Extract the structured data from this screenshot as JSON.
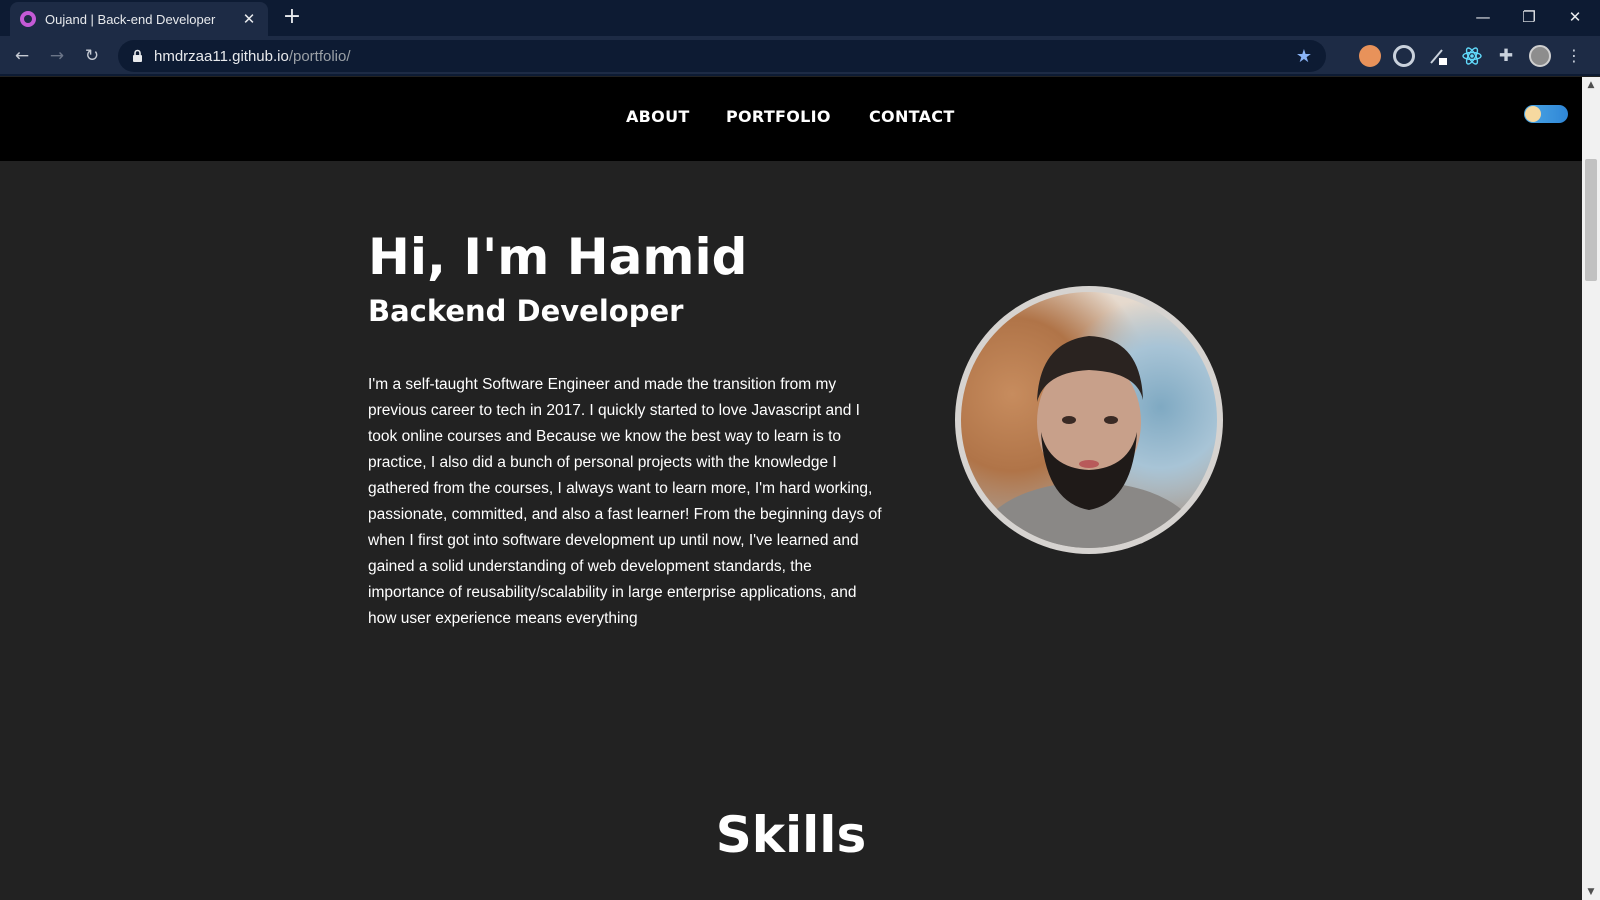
{
  "browser": {
    "tab_title": "Oujand | Back-end Developer",
    "new_tab_label": "+",
    "url_host": "hmdrzaa11.github.io",
    "url_path": "/portfolio/",
    "window_controls": {
      "minimize": "—",
      "restore": "❐",
      "close": "✕"
    },
    "nav": {
      "back": "←",
      "forward": "→",
      "reload": "↻"
    },
    "icons": [
      "lock-icon",
      "star-icon",
      "extension-icons",
      "puzzle-icon",
      "profile-avatar",
      "menu-icon"
    ]
  },
  "header": {
    "nav_links": [
      "ABOUT",
      "PORTFOLIO",
      "CONTACT"
    ]
  },
  "hero": {
    "title": "Hi, I'm Hamid",
    "subtitle": "Backend Developer",
    "bio": "I'm a self-taught Software Engineer and made the transition from my previous career to tech in 2017. I quickly started to love Javascript and I took online courses and Because we know the best way to learn is to practice, I also did a bunch of personal projects with the knowledge I gathered from the courses, I always want to learn more, I'm hard working, passionate, committed, and also a fast learner! From the beginning days of when I first got into software development up until now, I've learned and gained a solid understanding of web development standards, the importance of reusability/scalability in large enterprise applications, and how user experience means everything"
  },
  "skills": {
    "title": "Skills"
  },
  "colors": {
    "page_bg": "#222222",
    "header_bg": "#000000",
    "chrome_bg": "#0d1b33",
    "toggle_accent": "#3a96e0"
  }
}
